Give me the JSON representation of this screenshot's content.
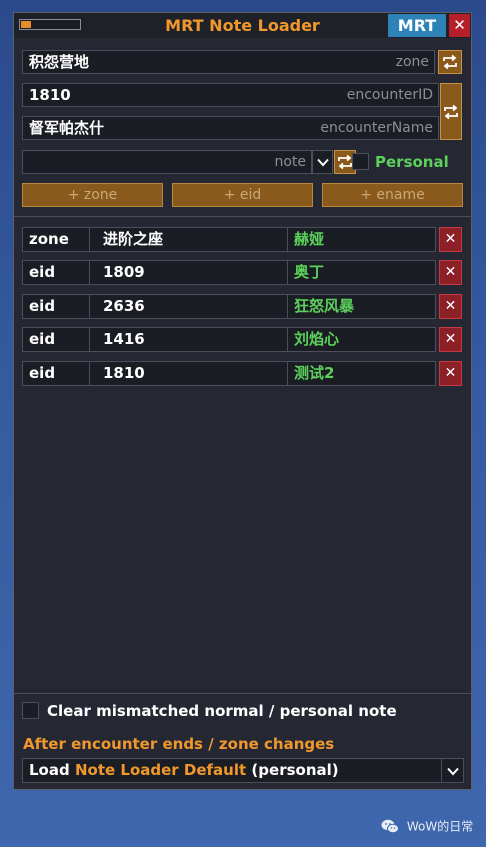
{
  "window": {
    "title": "MRT Note Loader",
    "mrt_button": "MRT",
    "close_glyph": "✕",
    "progress": 0.18
  },
  "filters": {
    "zone_value": "积怨营地",
    "zone_placeholder": "zone",
    "encounter_id_value": "1810",
    "encounter_id_placeholder": "encounterID",
    "encounter_name_value": "督军帕杰什",
    "encounter_name_placeholder": "encounterName",
    "note_value": "",
    "note_placeholder": "note",
    "personal_label": "Personal",
    "personal_checked": false
  },
  "buttons": {
    "add_zone": "+ zone",
    "add_eid": "+ eid",
    "add_ename": "+ ename"
  },
  "rules": [
    {
      "type": "zone",
      "id": "进阶之座",
      "note": "赫娅"
    },
    {
      "type": "eid",
      "id": "1809",
      "note": "奥丁"
    },
    {
      "type": "eid",
      "id": "2636",
      "note": "狂怒风暴"
    },
    {
      "type": "eid",
      "id": "1416",
      "note": "刘焰心"
    },
    {
      "type": "eid",
      "id": "1810",
      "note": "测试2"
    }
  ],
  "footer": {
    "clear_label": "Clear mismatched normal / personal note",
    "clear_checked": false,
    "after_label": "After encounter ends / zone changes",
    "load_prefix": "Load",
    "load_highlight": "Note Loader Default",
    "load_suffix": "(personal)"
  },
  "watermark": {
    "text": "WoW的日常",
    "icon": "wechat-icon"
  },
  "colors": {
    "accent_orange": "#f0982c",
    "green": "#5bd05b",
    "mrt_blue": "#2d83b7",
    "delete_red": "#8d1f27",
    "panel_bg": "#252833"
  }
}
